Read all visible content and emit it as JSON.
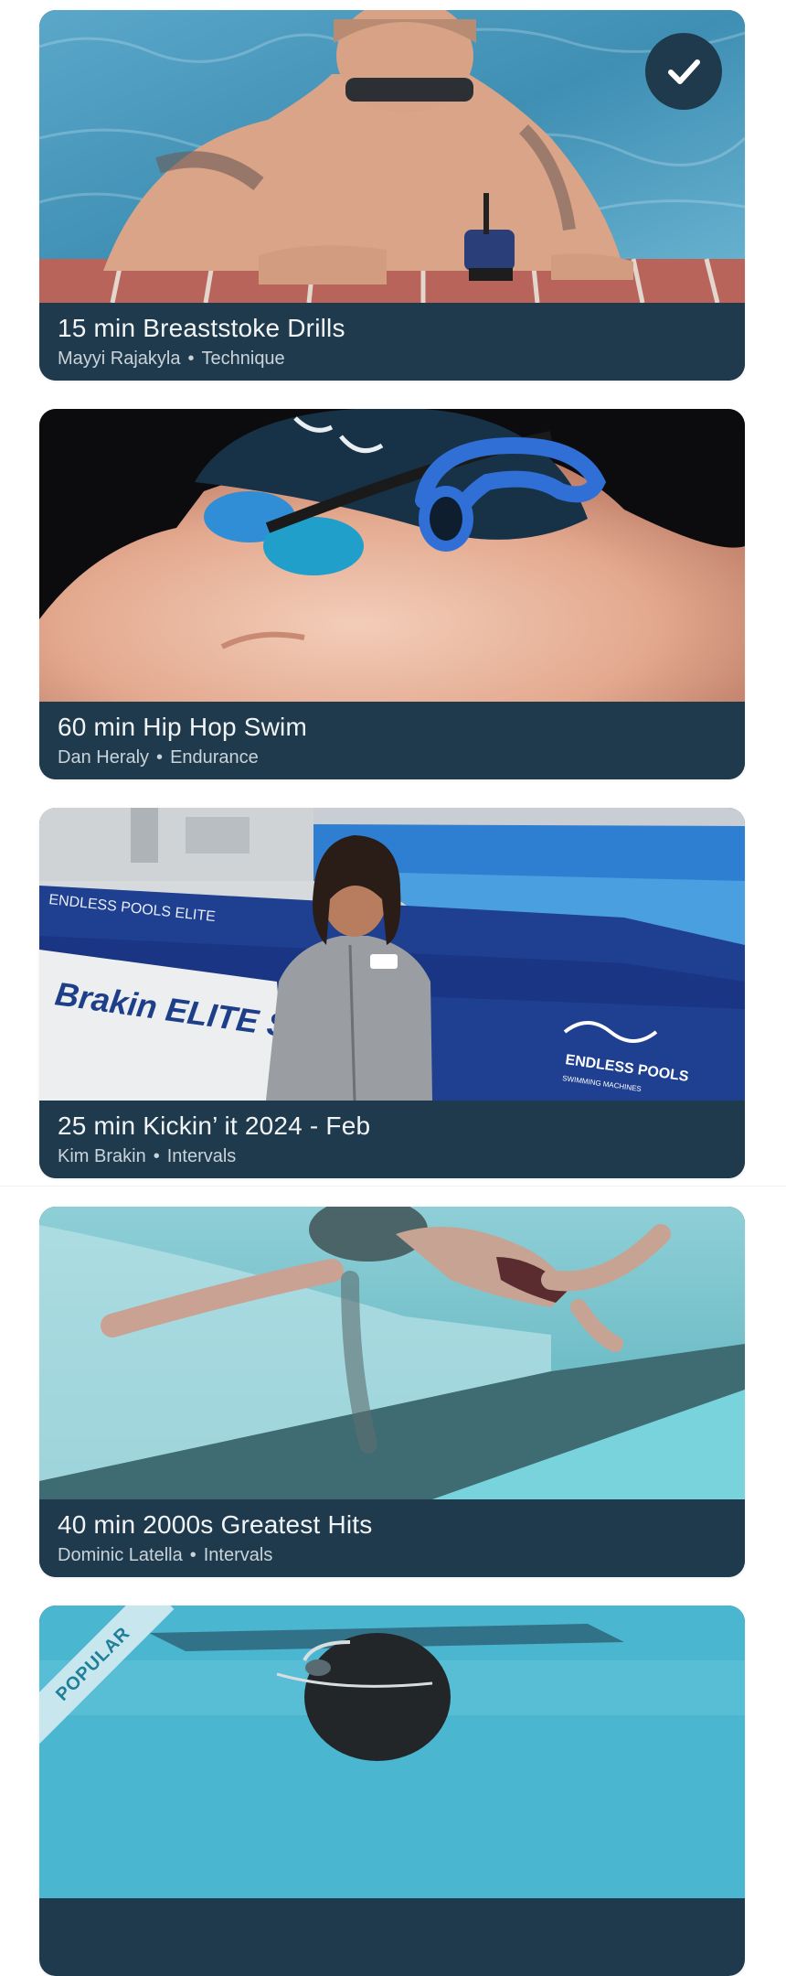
{
  "workouts": [
    {
      "title": "15 min Breaststoke Drills",
      "instructor": "Mayyi Rajakyla",
      "separator": "•",
      "category": "Technique",
      "completed": true,
      "completed_icon": "check-icon"
    },
    {
      "title": "60 min Hip Hop Swim",
      "instructor": "Dan Heraly",
      "separator": "•",
      "category": "Endurance"
    },
    {
      "title": "25 min Kickin’ it 2024 - Feb",
      "instructor": "Kim Brakin",
      "separator": "•",
      "category": "Intervals",
      "pool_sign": "Brakin ELITE SWIM",
      "pool_brand": "ENDLESS POOLS",
      "pool_brand_sub": "SWIMMING MACHINES",
      "pool_elite_label": "ENDLESS POOLS ELITE"
    },
    {
      "title": "40 min 2000s Greatest Hits",
      "instructor": "Dominic Latella",
      "separator": "•",
      "category": "Intervals"
    },
    {
      "badge": "POPULAR"
    }
  ],
  "colors": {
    "card_caption": "#1f3a4c",
    "title_text": "#f2f5f7",
    "meta_text": "#c9d3da",
    "ribbon_bg": "#c7e6ee",
    "ribbon_text": "#1f7f99"
  }
}
